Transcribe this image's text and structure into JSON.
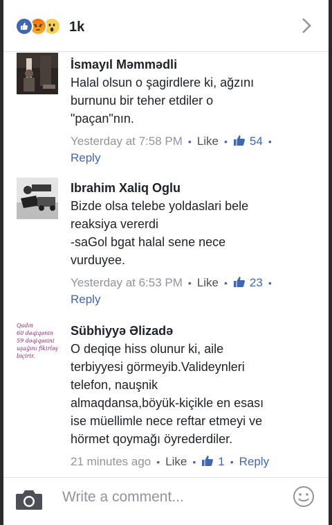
{
  "header": {
    "reaction_count": "1k"
  },
  "comments": [
    {
      "author": "İsmayıl Məmmədli",
      "text": "Halal olsun o şagirdlere ki, ağzını\nburnunu bir teher etdiler o\n\"paçan\"nın.",
      "time": "Yesterday at 7:58 PM",
      "like_label": "Like",
      "likes": "54",
      "reply_label": "Reply"
    },
    {
      "author": "Ibrahim Xaliq Oglu",
      "text": "Bizde olsa telebe yoldaslari bele\nreaksiya vererdi\n-saGol bgat halal sene nece\nvurduyee.",
      "time": "Yesterday at 6:53 PM",
      "like_label": "Like",
      "likes": "23",
      "reply_label": "Reply"
    },
    {
      "author": "Sübhiyyə Əlizadə",
      "avatar_text": [
        "Qadın",
        "60 dəqiqənin",
        "59 dəqiqəsini",
        "uşağını fikirləşə",
        "biçirir."
      ],
      "text": "O deqiqe hiss olunur ki, aile\nterbiyyesi görmeyib.Valideynleri\ntelefon, nauşnik\nalmaqdansa,böyük-kiçikle en esası\nise müellimle nece reftar etmeyi ve\nhörmet qoymağı öyrederdiler.",
      "time": "21 minutes ago",
      "like_label": "Like",
      "likes": "1",
      "reply_label": "Reply"
    }
  ],
  "composer": {
    "placeholder": "Write a comment..."
  },
  "colors": {
    "brand": "#4267b2",
    "text": "#1d2129",
    "muted": "#90949c"
  },
  "icons": [
    "like-reaction-icon",
    "angry-reaction-icon",
    "wow-reaction-icon",
    "chevron-right-icon",
    "thumbs-up-icon",
    "camera-icon",
    "smiley-icon"
  ]
}
